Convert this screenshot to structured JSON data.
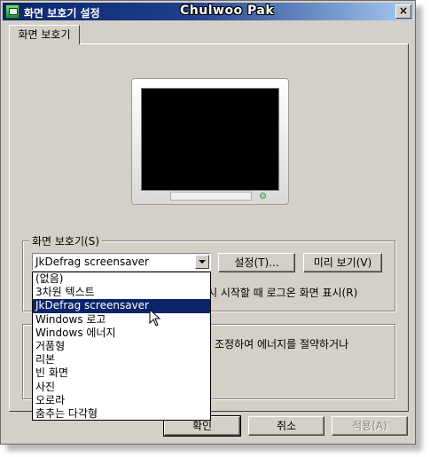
{
  "window": {
    "title": "화면 보호기 설정",
    "watermark": "Chulwoo Pak",
    "close_label": "×"
  },
  "tabs": [
    {
      "label": "화면 보호기"
    }
  ],
  "screensaver_group": {
    "title": "화면 보호기(S)",
    "selected_value": "JkDefrag screensaver",
    "settings_label": "설정(T)...",
    "preview_label": "미리 보기(V)",
    "resume_text_partial": "시 시작할 때 로그온 화면 표시(R)"
  },
  "power_group": {
    "text_partial": "조정하여 에너지를 절약하거나"
  },
  "dropdown": {
    "items": [
      {
        "label": "(없음)"
      },
      {
        "label": "3차원 텍스트"
      },
      {
        "label": "JkDefrag screensaver",
        "selected": true
      },
      {
        "label": "Windows 로고"
      },
      {
        "label": "Windows 에너지"
      },
      {
        "label": "거품형"
      },
      {
        "label": "리본"
      },
      {
        "label": "빈 화면"
      },
      {
        "label": "사진"
      },
      {
        "label": "오로라"
      },
      {
        "label": "춤추는 다각형"
      }
    ]
  },
  "footer": {
    "ok_label": "확인",
    "cancel_label": "취소",
    "apply_label": "적용(A)"
  },
  "colors": {
    "titlebar_start": "#0a246a",
    "titlebar_end": "#a6caf0",
    "selection": "#0a246a",
    "dialog_face": "#d4d0c8"
  }
}
